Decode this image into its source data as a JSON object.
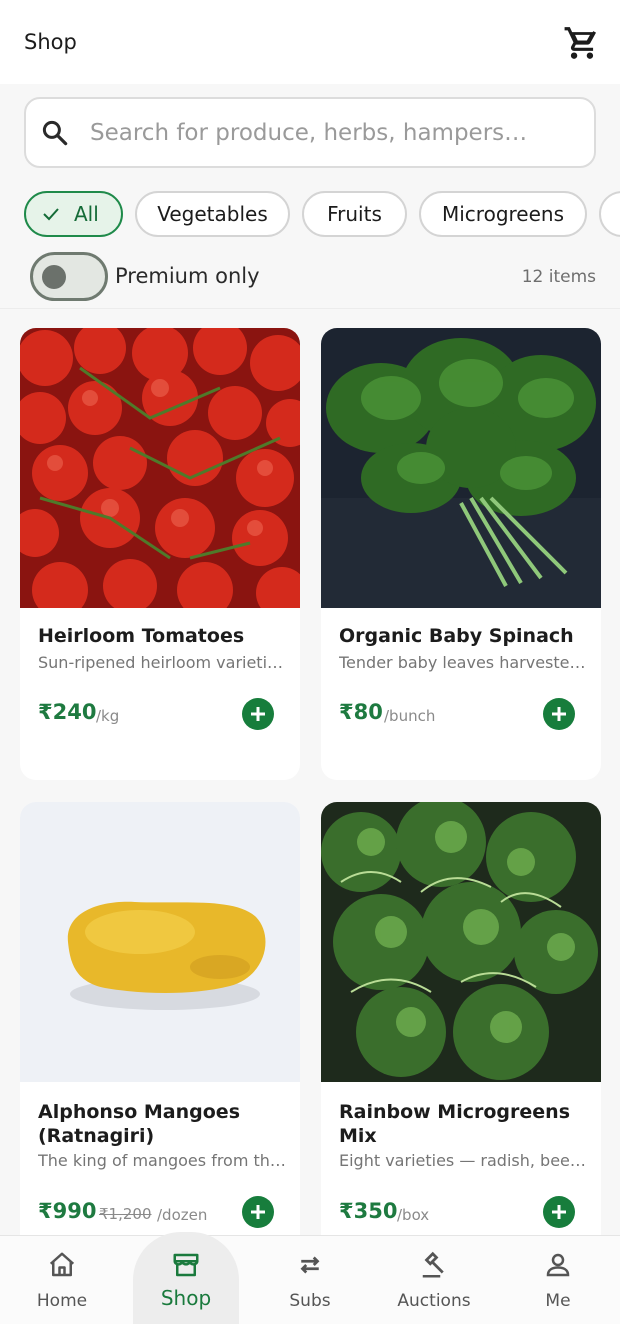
{
  "appbar": {
    "title": "Shop",
    "cart_icon": "cart-icon"
  },
  "search": {
    "placeholder": "Search for produce, herbs, hampers…",
    "value": ""
  },
  "filters": {
    "chips": [
      {
        "label": "All",
        "selected": true
      },
      {
        "label": "Vegetables",
        "selected": false
      },
      {
        "label": "Fruits",
        "selected": false
      },
      {
        "label": "Microgreens",
        "selected": false
      }
    ]
  },
  "premium_toggle": {
    "label": "Premium only",
    "on": false
  },
  "items_count": "12 items",
  "products": [
    {
      "title": "Heirloom Tomatoes",
      "desc": "Sun-ripened heirloom varieties grown organically",
      "price": "₹240",
      "unit": "/kg"
    },
    {
      "title": "Organic Baby Spinach",
      "desc": "Tender baby leaves harvested fresh every morning",
      "price": "₹80",
      "unit": "/bunch"
    },
    {
      "title": "Alphonso Mangoes (Ratnagiri)",
      "desc": "The king of mangoes from the Konkan coast",
      "price": "₹990",
      "old_price": "₹1,200",
      "unit": "/dozen"
    },
    {
      "title": "Rainbow Microgreens Mix",
      "desc": "Eight varieties — radish, beet, pea and more",
      "price": "₹350",
      "unit": "/box"
    }
  ],
  "bottom_nav": {
    "items": [
      {
        "label": "Home",
        "icon": "home-icon"
      },
      {
        "label": "Shop",
        "icon": "store-icon",
        "active": true
      },
      {
        "label": "Subs",
        "icon": "repeat-icon"
      },
      {
        "label": "Auctions",
        "icon": "gavel-icon"
      },
      {
        "label": "Me",
        "icon": "person-icon"
      }
    ]
  },
  "colors": {
    "accent": "#1e7a40",
    "chip_selected_bg": "#e6f3e9"
  }
}
